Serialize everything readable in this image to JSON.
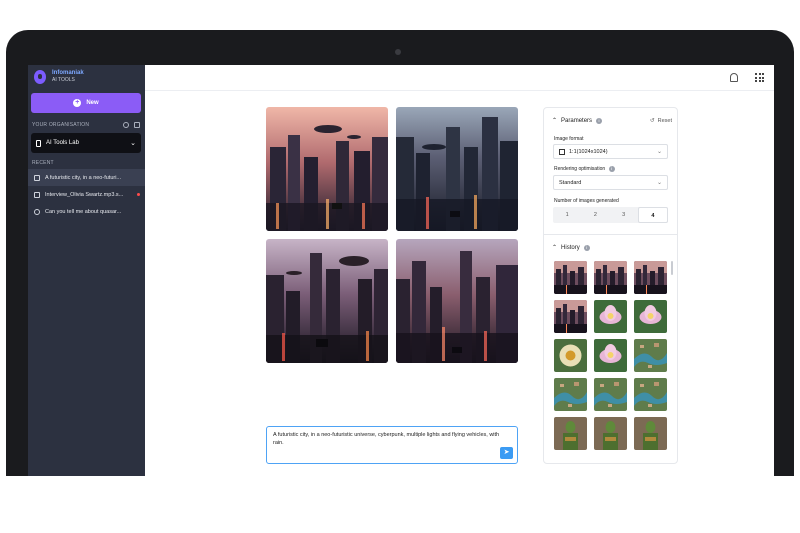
{
  "app": {
    "brand_name": "Infomaniak",
    "brand_sub": "AI TOOLS",
    "new_label": "New"
  },
  "sidebar": {
    "organisation_label": "YOUR ORGANISATION",
    "organisation_selected": "AI Tools Lab",
    "recent_label": "RECENT",
    "recent": [
      {
        "label": "A futuristic city, in a neo-futuri...",
        "icon": "image-edit-icon"
      },
      {
        "label": "Interview_Olivia Swartz.mp3.s...",
        "icon": "file-edit-icon"
      },
      {
        "label": "Can you tell me about quasar...",
        "icon": "chat-icon"
      }
    ]
  },
  "prompt": {
    "text": "A futuristic city, in a neo-futuristic universe, cyberpunk, multiple lights and flying vehicles, with rain."
  },
  "parameters": {
    "title": "Parameters",
    "reset_label": "Reset",
    "image_format_label": "Image format",
    "image_format_value": "1:1(1024x1024)",
    "rendering_label": "Rendering optimisation",
    "rendering_value": "Standard",
    "count_label": "Number of images generated",
    "count_options": [
      "1",
      "2",
      "3",
      "4"
    ],
    "count_selected": "4"
  },
  "history": {
    "title": "History",
    "thumbs": [
      "city",
      "city",
      "city",
      "city",
      "lotus",
      "lotus",
      "flower",
      "lotus",
      "aerial",
      "aerial",
      "aerial",
      "aerial",
      "warrior",
      "warrior",
      "warrior"
    ]
  },
  "colors": {
    "accent": "#8b5cf6",
    "sidebar_bg": "#2c3140",
    "prompt_border": "#4ea3f5"
  }
}
